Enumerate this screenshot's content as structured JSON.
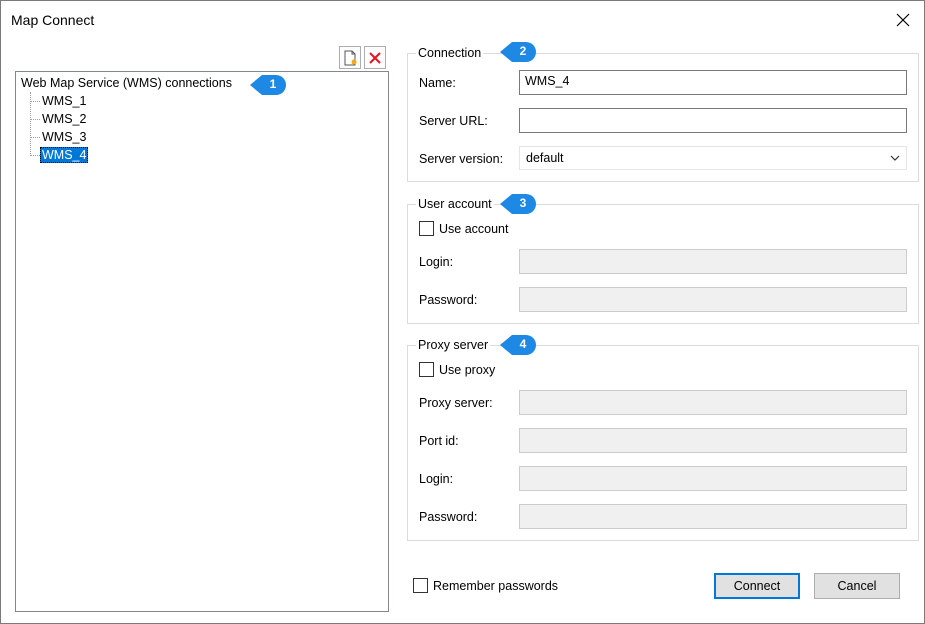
{
  "window": {
    "title": "Map Connect"
  },
  "toolbar": {
    "new_icon": "new-connection-icon",
    "delete_icon": "delete-connection-icon",
    "delete_color": "#e81123"
  },
  "tree": {
    "root": "Web Map Service (WMS) connections",
    "items": [
      "WMS_1",
      "WMS_2",
      "WMS_3",
      "WMS_4"
    ],
    "selected": "WMS_4",
    "selection_color": "#0078d7"
  },
  "callouts": [
    "1",
    "2",
    "3",
    "4"
  ],
  "callout_color": "#1e88e5",
  "connection": {
    "legend": "Connection",
    "name_label": "Name:",
    "name_value": "WMS_4",
    "url_label": "Server URL:",
    "url_value": "",
    "version_label": "Server version:",
    "version_value": "default"
  },
  "user_account": {
    "legend": "User account",
    "use_label": "Use account",
    "use_checked": false,
    "login_label": "Login:",
    "password_label": "Password:"
  },
  "proxy": {
    "legend": "Proxy server",
    "use_label": "Use proxy",
    "use_checked": false,
    "server_label": "Proxy server:",
    "port_label": "Port id:",
    "login_label": "Login:",
    "password_label": "Password:"
  },
  "footer": {
    "remember_label": "Remember passwords",
    "remember_checked": false,
    "connect_label": "Connect",
    "cancel_label": "Cancel"
  }
}
